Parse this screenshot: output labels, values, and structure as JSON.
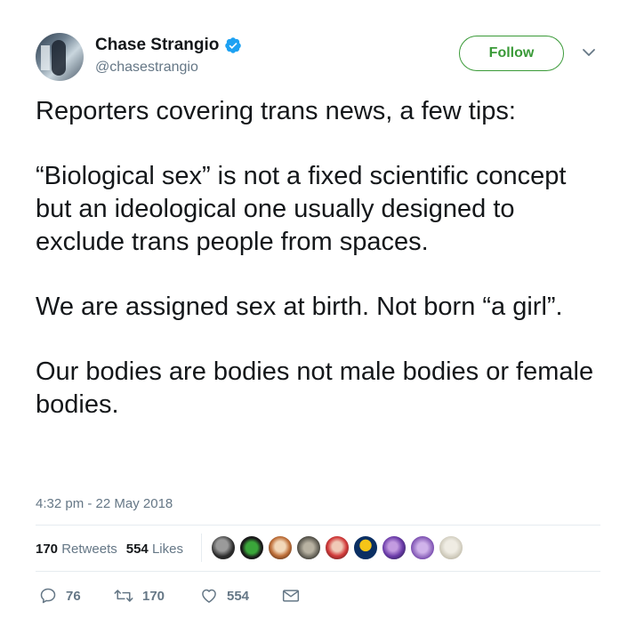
{
  "author": {
    "name": "Chase Strangio",
    "handle": "@chasestrangio",
    "verified_icon": "verified-badge-icon"
  },
  "follow_label": "Follow",
  "tweet": {
    "paragraphs": [
      "Reporters covering trans news, a few tips:",
      "“Biological sex” is not a fixed scientific concept but an ideological one usually designed to exclude trans people from spaces.",
      "We are assigned sex at birth. Not born “a girl”.",
      "Our bodies are bodies not male bodies or female bodies."
    ],
    "timestamp": "4:32 pm - 22 May 2018"
  },
  "stats": {
    "retweets_count": "170",
    "retweets_label": "Retweets",
    "likes_count": "554",
    "likes_label": "Likes"
  },
  "actions": {
    "replies": "76",
    "retweets": "170",
    "likes": "554"
  },
  "colors": {
    "follow_green": "#3a9a38",
    "verified_blue": "#1da1f2",
    "muted": "#657786"
  }
}
